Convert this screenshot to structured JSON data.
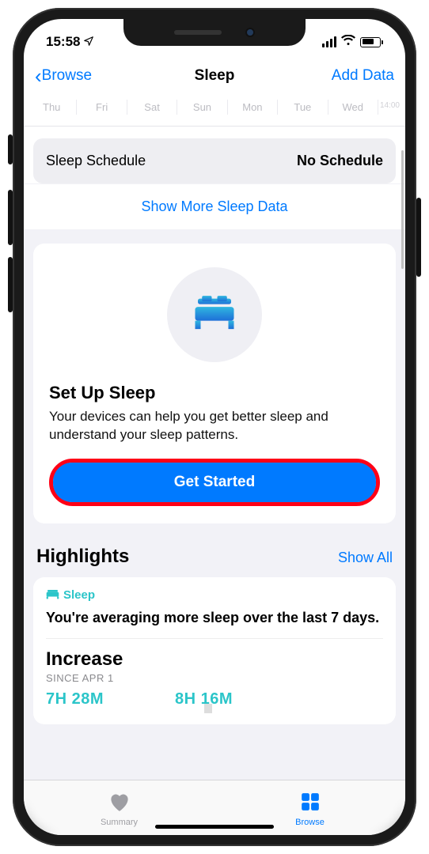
{
  "status": {
    "time": "15:58",
    "location_icon": "location-arrow"
  },
  "nav": {
    "back_label": "Browse",
    "title": "Sleep",
    "action_label": "Add Data"
  },
  "days": [
    "Thu",
    "Fri",
    "Sat",
    "Sun",
    "Mon",
    "Tue",
    "Wed"
  ],
  "day_axis_tick": "14:00",
  "schedule": {
    "label": "Sleep Schedule",
    "value": "No Schedule"
  },
  "show_more_label": "Show More Sleep Data",
  "setup": {
    "title": "Set Up Sleep",
    "description": "Your devices can help you get better sleep and understand your sleep patterns.",
    "button_label": "Get Started"
  },
  "highlights": {
    "title": "Highlights",
    "show_all_label": "Show All",
    "card": {
      "category": "Sleep",
      "summary": "You're averaging more sleep over the last 7 days.",
      "metric_title": "Increase",
      "since_label": "SINCE APR 1",
      "value1": "7H 28M",
      "value2": "8H 16M"
    }
  },
  "tabs": {
    "summary_label": "Summary",
    "browse_label": "Browse"
  }
}
